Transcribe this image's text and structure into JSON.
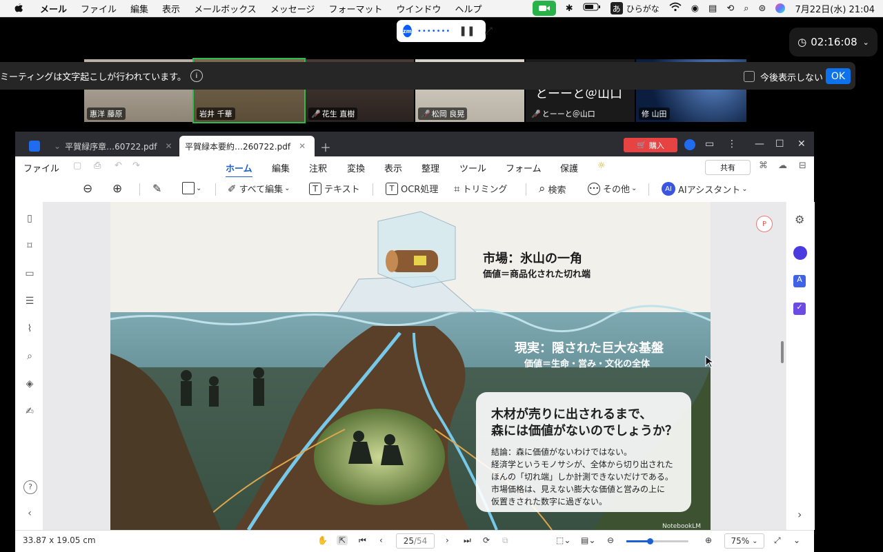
{
  "menubar": {
    "app": "メール",
    "items": [
      "ファイル",
      "編集",
      "表示",
      "メールボックス",
      "メッセージ",
      "フォーマット",
      "ウインドウ",
      "ヘルプ"
    ],
    "ime": "あ",
    "ime_label": "ひらがな",
    "datetime": "7月22日(水)  21:04"
  },
  "zoom": {
    "logo": "zm",
    "timer": "02:16:08",
    "caption_text": "ミーティングは文字起こしが行われています。",
    "dont_show": "今後表示しない",
    "ok": "OK",
    "participants": [
      {
        "name": "惠洋 藤原",
        "muted": false
      },
      {
        "name": "岩井 千華",
        "muted": false
      },
      {
        "name": "花生 直樹",
        "muted": true
      },
      {
        "name": "松岡 良晃",
        "muted": true
      },
      {
        "name": "とーーと＠山口",
        "muted": true
      },
      {
        "name": "修 山田",
        "muted": false
      }
    ],
    "tile5_big_text": "とーーと＠山口"
  },
  "pdf": {
    "tabs": [
      {
        "label": "平賀緑序章…60722.pdf"
      },
      {
        "label": "平賀緑本要約…260722.pdf"
      }
    ],
    "buy": "購入",
    "file": "ファイル",
    "ribbon": [
      "ホーム",
      "編集",
      "注釈",
      "変換",
      "表示",
      "整理",
      "ツール",
      "フォーム",
      "保護"
    ],
    "share": "共有",
    "tools": {
      "edit_all": "すべて編集",
      "text": "テキスト",
      "ocr": "OCR処理",
      "trim": "トリミング",
      "search": "検索",
      "more": "その他",
      "ai": "AIアシスタント",
      "ai_badge": "AI"
    },
    "slide": {
      "market_title": "市場：氷山の一角",
      "market_sub": "価値＝商品化された切れ端",
      "reality_title": "現実：隠された巨大な基盤",
      "reality_sub": "価値＝生命・営み・文化の全体",
      "question": [
        "木材が売りに出されるまで、",
        "森には価値がないのでしょうか？"
      ],
      "answer": [
        "結論：森に価値がないわけではない。",
        "経済学というモノサシが、全体から切り出された",
        "ほんの「切れ端」しか計測できないだけである。",
        "市場価格は、見えない膨大な価値と営みの上に",
        "仮置きされた数字に過ぎない。"
      ],
      "watermark": "NotebookLM"
    },
    "status": {
      "size": "33.87 x 19.05 cm",
      "page": "25",
      "total": "/54",
      "zoom": "75%"
    }
  },
  "colors": {
    "accent": "#1a5fd6",
    "buy": "#e84343",
    "zoom_ok": "#0e72ed"
  }
}
